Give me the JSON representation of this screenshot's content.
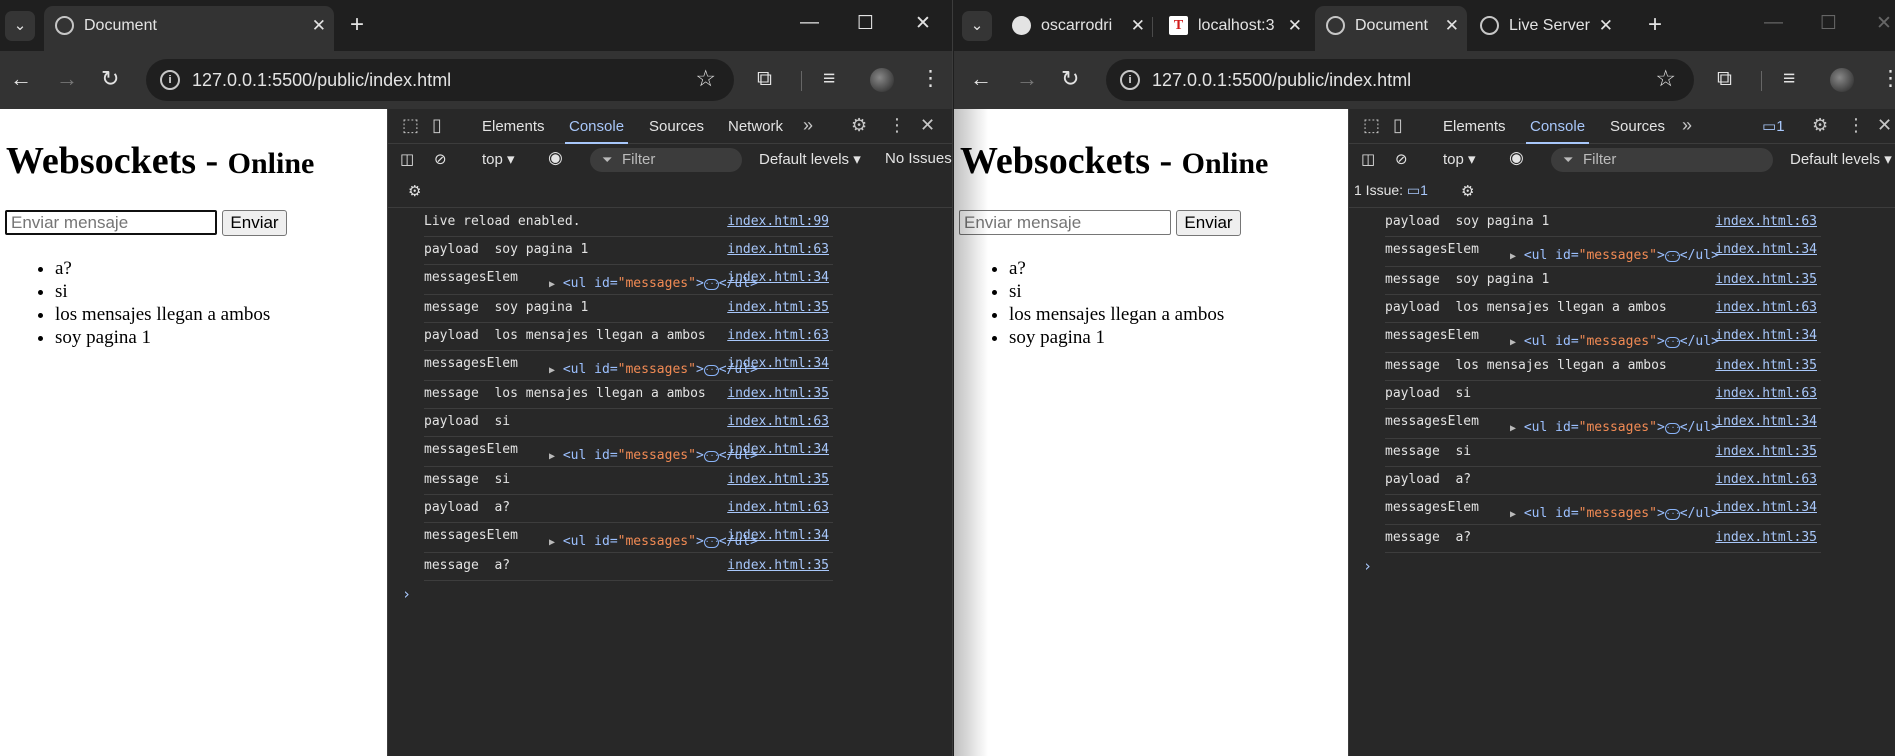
{
  "left": {
    "tabs": [
      {
        "title": "Document"
      }
    ],
    "url": "127.0.0.1:5500/public/index.html",
    "page": {
      "title": "Websockets - ",
      "status": "Online",
      "input_placeholder": "Enviar mensaje",
      "send_label": "Enviar",
      "messages": [
        "a?",
        "si",
        "los mensajes llegan a ambos",
        "soy pagina 1"
      ]
    },
    "devtools": {
      "tabs": [
        "Elements",
        "Console",
        "Sources",
        "Network"
      ],
      "active_tab": "Console",
      "context": "top",
      "filter_placeholder": "Filter",
      "levels": "Default levels",
      "issues": "No Issues",
      "log": [
        {
          "text": "Live reload enabled.",
          "src": "index.html:99"
        },
        {
          "text": "payload  soy pagina 1",
          "src": "index.html:63"
        },
        {
          "text": "messagesElem",
          "node": true,
          "src": "index.html:34"
        },
        {
          "text": "message  soy pagina 1",
          "src": "index.html:35"
        },
        {
          "text": "payload  los mensajes llegan a ambos",
          "src": "index.html:63"
        },
        {
          "text": "messagesElem",
          "node": true,
          "src": "index.html:34"
        },
        {
          "text": "message  los mensajes llegan a ambos",
          "src": "index.html:35"
        },
        {
          "text": "payload  si",
          "src": "index.html:63"
        },
        {
          "text": "messagesElem",
          "node": true,
          "src": "index.html:34"
        },
        {
          "text": "message  si",
          "src": "index.html:35"
        },
        {
          "text": "payload  a?",
          "src": "index.html:63"
        },
        {
          "text": "messagesElem",
          "node": true,
          "src": "index.html:34"
        },
        {
          "text": "message  a?",
          "src": "index.html:35"
        }
      ]
    }
  },
  "right": {
    "tabs": [
      {
        "title": "oscarrodri"
      },
      {
        "title": "localhost:3"
      },
      {
        "title": "Document"
      },
      {
        "title": "Live Server"
      }
    ],
    "url": "127.0.0.1:5500/public/index.html",
    "page": {
      "title": "Websockets - ",
      "status": "Online",
      "input_placeholder": "Enviar mensaje",
      "send_label": "Enviar",
      "messages": [
        "a?",
        "si",
        "los mensajes llegan a ambos",
        "soy pagina 1"
      ]
    },
    "devtools": {
      "tabs": [
        "Elements",
        "Console",
        "Sources"
      ],
      "active_tab": "Console",
      "issue_badge": "1",
      "context": "top",
      "filter_placeholder": "Filter",
      "levels": "Default levels",
      "issues_label": "1 Issue:",
      "issues_count": "1",
      "log": [
        {
          "text": "payload  soy pagina 1",
          "src": "index.html:63"
        },
        {
          "text": "messagesElem",
          "node": true,
          "src": "index.html:34"
        },
        {
          "text": "message  soy pagina 1",
          "src": "index.html:35"
        },
        {
          "text": "payload  los mensajes llegan a ambos",
          "src": "index.html:63"
        },
        {
          "text": "messagesElem",
          "node": true,
          "src": "index.html:34"
        },
        {
          "text": "message  los mensajes llegan a ambos",
          "src": "index.html:35"
        },
        {
          "text": "payload  si",
          "src": "index.html:63"
        },
        {
          "text": "messagesElem",
          "node": true,
          "src": "index.html:34"
        },
        {
          "text": "message  si",
          "src": "index.html:35"
        },
        {
          "text": "payload  a?",
          "src": "index.html:63"
        },
        {
          "text": "messagesElem",
          "node": true,
          "src": "index.html:34"
        },
        {
          "text": "message  a?",
          "src": "index.html:35"
        }
      ]
    }
  },
  "node_html": {
    "open": "<ul id=",
    "attr_value": "\"messages\"",
    "close": "</ul>",
    "more": "···"
  },
  "icons": {
    "tab_search": "chevron-down-icon",
    "new_tab": "plus-icon",
    "back": "arrow-left-icon",
    "forward": "arrow-right-icon",
    "reload": "reload-icon",
    "site_info": "info-icon",
    "bookmark": "star-icon",
    "extensions": "puzzle-icon",
    "media": "media-control-icon",
    "menu": "kebab-menu-icon"
  },
  "colors": {
    "chrome_bg": "#1f1f1f",
    "toolbar": "#333333",
    "devtools_bg": "#282828",
    "link": "#a8c7fa",
    "accent": "#a8c7fa"
  }
}
